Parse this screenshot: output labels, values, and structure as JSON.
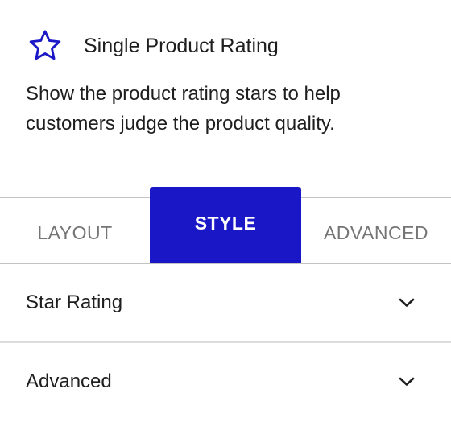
{
  "block": {
    "icon": "star-outline-icon",
    "title": "Single Product Rating",
    "description": "Show the product rating stars to help customers judge the product quality."
  },
  "tabs": [
    {
      "label": "Layout",
      "active": false
    },
    {
      "label": "Style",
      "active": true
    },
    {
      "label": "Advanced",
      "active": false
    }
  ],
  "panels": [
    {
      "title": "Star Rating",
      "icon": "chevron-down-icon",
      "expanded": false
    },
    {
      "title": "Advanced",
      "icon": "chevron-down-icon",
      "expanded": false
    }
  ],
  "colors": {
    "accent": "#1a17c7",
    "star_icon": "#1a17c7",
    "text": "#1e1e1e",
    "muted_tab": "#757575",
    "divider": "#c3c3c3"
  }
}
